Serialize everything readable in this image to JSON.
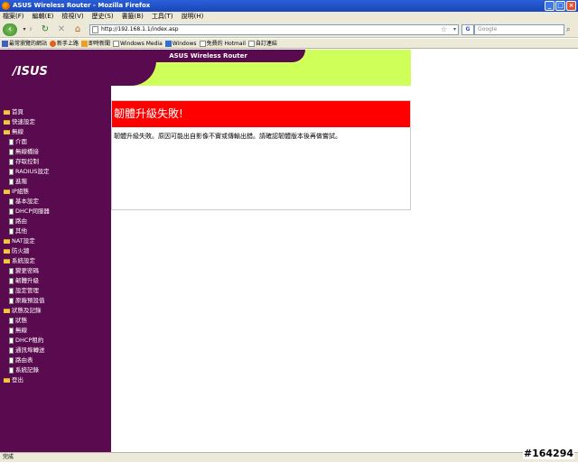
{
  "window": {
    "title": "ASUS Wireless Router - Mozilla Firefox"
  },
  "menubar": [
    "檔案(F)",
    "編輯(E)",
    "檢視(V)",
    "歷史(S)",
    "書籤(B)",
    "工具(T)",
    "說明(H)"
  ],
  "navbar": {
    "url": "http://192.168.1.1/index.asp",
    "search_placeholder": "Google",
    "search_engine": "G"
  },
  "bookmarks": [
    {
      "label": "最常瀏覽的網站",
      "icon": "bookmark-icon"
    },
    {
      "label": "新手上路",
      "icon": "firefox-icon"
    },
    {
      "label": "即時新聞",
      "icon": "rss-icon"
    },
    {
      "label": "Windows Media",
      "icon": "page-icon"
    },
    {
      "label": "Windows",
      "icon": "windows-icon"
    },
    {
      "label": "免費的 Hotmail",
      "icon": "page-icon"
    },
    {
      "label": "自訂連結",
      "icon": "page-icon"
    }
  ],
  "header": {
    "logo": "/ISUS",
    "title": "ASUS Wireless Router"
  },
  "sidebar": {
    "items": [
      {
        "label": "首頁",
        "type": "folder",
        "level": 0
      },
      {
        "label": "快速設定",
        "type": "folder",
        "level": 0
      },
      {
        "label": "無線",
        "type": "folder",
        "level": 0
      },
      {
        "label": "介面",
        "type": "doc",
        "level": 1
      },
      {
        "label": "無線橋接",
        "type": "doc",
        "level": 1
      },
      {
        "label": "存取控制",
        "type": "doc",
        "level": 1
      },
      {
        "label": "RADIUS設定",
        "type": "doc",
        "level": 1
      },
      {
        "label": "進階",
        "type": "doc",
        "level": 1
      },
      {
        "label": "IP組態",
        "type": "folder",
        "level": 0
      },
      {
        "label": "基本設定",
        "type": "doc",
        "level": 1
      },
      {
        "label": "DHCP伺服器",
        "type": "doc",
        "level": 1
      },
      {
        "label": "路由",
        "type": "doc",
        "level": 1
      },
      {
        "label": "其他",
        "type": "doc",
        "level": 1
      },
      {
        "label": "NAT設定",
        "type": "folder",
        "level": 0
      },
      {
        "label": "防火牆",
        "type": "folder",
        "level": 0
      },
      {
        "label": "系統設定",
        "type": "folder",
        "level": 0
      },
      {
        "label": "變更密碼",
        "type": "doc",
        "level": 1
      },
      {
        "label": "韌體升級",
        "type": "doc",
        "level": 1
      },
      {
        "label": "設定管理",
        "type": "doc",
        "level": 1
      },
      {
        "label": "原廠預設值",
        "type": "doc",
        "level": 1
      },
      {
        "label": "狀態及記錄",
        "type": "folder",
        "level": 0
      },
      {
        "label": "狀態",
        "type": "doc",
        "level": 1
      },
      {
        "label": "無線",
        "type": "doc",
        "level": 1
      },
      {
        "label": "DHCP租約",
        "type": "doc",
        "level": 1
      },
      {
        "label": "通訊埠轉送",
        "type": "doc",
        "level": 1
      },
      {
        "label": "路由表",
        "type": "doc",
        "level": 1
      },
      {
        "label": "系統記錄",
        "type": "doc",
        "level": 1
      },
      {
        "label": "登出",
        "type": "folder",
        "level": 0
      }
    ]
  },
  "error": {
    "title": "韌體升級失敗!",
    "message": "韌體升級失敗。原因可能出自影像不實或傳輸出錯。請確認韌體版本後再做嘗試。"
  },
  "statusbar": {
    "text": "完成"
  },
  "watermark": "#164294",
  "colors": {
    "sidebar": "#5a0a4e",
    "banner": "#cfff59",
    "error": "#ff0000"
  }
}
